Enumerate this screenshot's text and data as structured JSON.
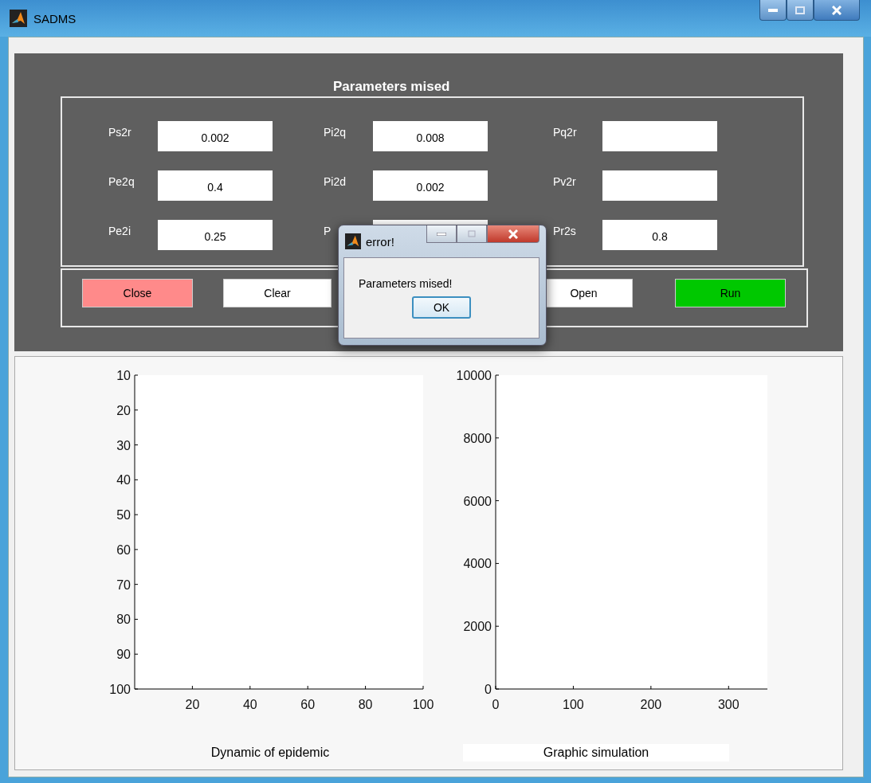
{
  "window": {
    "title": "SADMS"
  },
  "parameters": {
    "title": "Parameters mised",
    "columns": [
      [
        {
          "kind": "field",
          "label": "Ps2r",
          "value": "0.002"
        },
        {
          "kind": "field",
          "label": "Pe2q",
          "value": "0.4"
        },
        {
          "kind": "field",
          "label": "Pe2i",
          "value": "0.25"
        }
      ],
      [
        {
          "kind": "field",
          "label": "Pi2q",
          "value": "0.008"
        },
        {
          "kind": "field",
          "label": "Pi2d",
          "value": "0.002"
        },
        {
          "kind": "covered",
          "label": "P"
        }
      ],
      [
        {
          "kind": "field",
          "label": "Pq2r"
        },
        {
          "kind": "field",
          "label": "Pv2r"
        },
        {
          "kind": "field",
          "label": "Pr2s",
          "value": "0.8"
        }
      ]
    ]
  },
  "buttons": [
    {
      "label": "Close",
      "color": "#ff8a8a"
    },
    {
      "label": "Clear",
      "color": "#ffffff"
    },
    {
      "label": "Open",
      "color": "#ffffff"
    },
    {
      "label": "Run",
      "color": "#00c800"
    }
  ],
  "charts": [
    {
      "caption": "Dynamic of epidemic",
      "chart_data": {
        "type": "line",
        "xlim": [
          0,
          100
        ],
        "ylim": [
          100,
          10
        ],
        "xticks": [
          20,
          40,
          60,
          80,
          100
        ],
        "yticks": [
          10,
          20,
          30,
          40,
          50,
          60,
          70,
          80,
          90,
          100
        ]
      }
    },
    {
      "caption": "Graphic simulation",
      "chart_data": {
        "type": "line",
        "xlim": [
          0,
          350
        ],
        "ylim": [
          0,
          10000
        ],
        "xticks": [
          0,
          100,
          200,
          300
        ],
        "yticks": [
          0,
          2000,
          4000,
          6000,
          8000,
          10000
        ]
      }
    }
  ],
  "dialog": {
    "title": "error!",
    "message": "Parameters mised!",
    "button": "OK"
  }
}
